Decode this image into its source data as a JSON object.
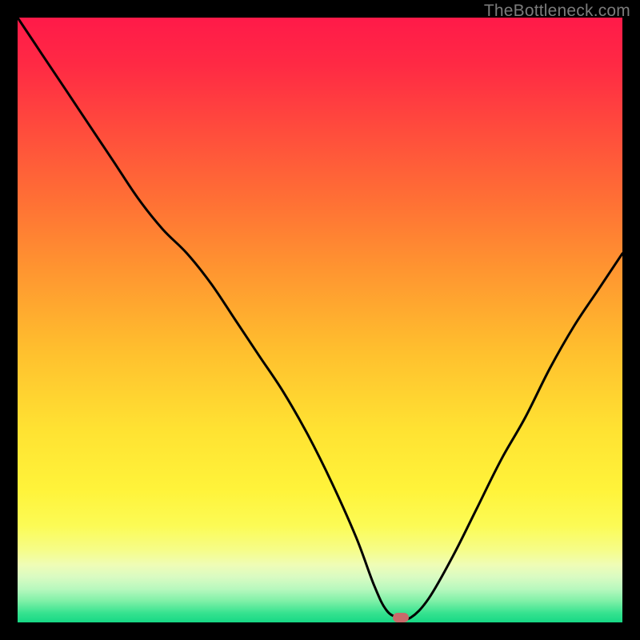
{
  "watermark": {
    "text": "TheBottleneck.com"
  },
  "colors": {
    "black": "#000000",
    "curve": "#000000",
    "marker": "#c96a6a",
    "gradient_stops": [
      {
        "offset": 0.0,
        "color": "#ff1a49"
      },
      {
        "offset": 0.08,
        "color": "#ff2a44"
      },
      {
        "offset": 0.18,
        "color": "#ff4a3d"
      },
      {
        "offset": 0.3,
        "color": "#ff6f35"
      },
      {
        "offset": 0.42,
        "color": "#ff9630"
      },
      {
        "offset": 0.55,
        "color": "#ffbf2e"
      },
      {
        "offset": 0.68,
        "color": "#ffe232"
      },
      {
        "offset": 0.78,
        "color": "#fff33a"
      },
      {
        "offset": 0.84,
        "color": "#fcfb55"
      },
      {
        "offset": 0.88,
        "color": "#f6fd88"
      },
      {
        "offset": 0.905,
        "color": "#effdb6"
      },
      {
        "offset": 0.925,
        "color": "#d9fbc2"
      },
      {
        "offset": 0.945,
        "color": "#b7f8be"
      },
      {
        "offset": 0.965,
        "color": "#7ef0a7"
      },
      {
        "offset": 0.985,
        "color": "#35e28f"
      },
      {
        "offset": 1.0,
        "color": "#17d885"
      }
    ]
  },
  "marker": {
    "x_pct": 63.3,
    "y_pct": 99.2
  },
  "chart_data": {
    "type": "line",
    "title": "",
    "xlabel": "",
    "ylabel": "",
    "xlim": [
      0,
      100
    ],
    "ylim": [
      0,
      100
    ],
    "grid": false,
    "legend": false,
    "series": [
      {
        "name": "bottleneck-curve",
        "x": [
          0.0,
          4,
          8,
          12,
          16,
          20,
          24,
          28,
          32,
          36,
          40,
          44,
          48,
          52,
          56,
          59,
          61,
          63,
          65,
          68,
          72,
          76,
          80,
          84,
          88,
          92,
          96,
          100
        ],
        "y": [
          100,
          94,
          88,
          82,
          76,
          70,
          65,
          61,
          56,
          50,
          44,
          38,
          31,
          23,
          14,
          6,
          2,
          0.8,
          0.8,
          4,
          11,
          19,
          27,
          34,
          42,
          49,
          55,
          61
        ]
      }
    ],
    "annotations": [
      {
        "type": "marker",
        "x": 63.3,
        "y": 0.8,
        "label": "optimal-point"
      }
    ]
  }
}
